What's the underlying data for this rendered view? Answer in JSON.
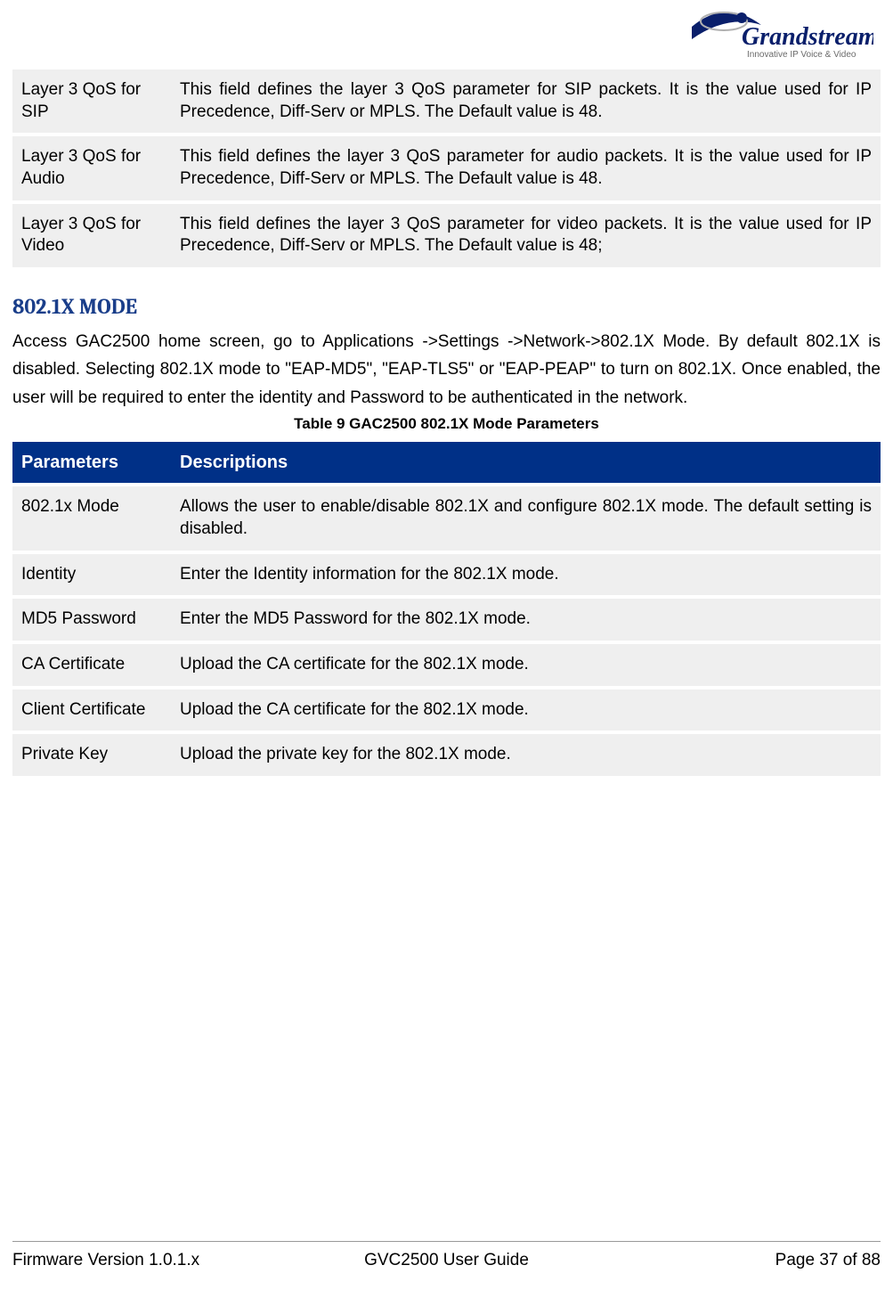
{
  "logo": {
    "brand_name": "Grandstream",
    "tagline": "Innovative IP Voice & Video"
  },
  "qos_table": {
    "rows": [
      {
        "param": "Layer 3 QoS for SIP",
        "desc": "This field defines the layer 3 QoS parameter for SIP packets. It is the value used for IP Precedence, Diff-Serv or MPLS. The Default value is 48."
      },
      {
        "param": "Layer 3 QoS for Audio",
        "desc": "This field defines the layer 3 QoS parameter for audio packets. It is the value used for IP Precedence, Diff-Serv or MPLS. The Default value is 48."
      },
      {
        "param": "Layer 3 QoS for Video",
        "desc": "This field defines the layer 3 QoS parameter for video packets. It is the value used for IP Precedence, Diff-Serv or MPLS. The Default value is 48;"
      }
    ]
  },
  "section": {
    "heading": "802.1X MODE",
    "paragraph": "Access GAC2500 home screen, go to Applications ->Settings ->Network->802.1X Mode. By default 802.1X is disabled. Selecting 802.1X mode to \"EAP-MD5\", \"EAP-TLS5\" or \"EAP-PEAP\" to turn on 802.1X. Once enabled, the user will be required to enter the identity and Password to be authenticated in the network."
  },
  "mode_table": {
    "caption": "Table 9 GAC2500 802.1X Mode Parameters",
    "header": {
      "param": "Parameters",
      "desc": "Descriptions"
    },
    "rows": [
      {
        "param": "802.1x Mode",
        "desc": "Allows the user to enable/disable 802.1X and configure 802.1X mode. The default setting is disabled."
      },
      {
        "param": "Identity",
        "desc": "Enter the Identity information for the 802.1X mode."
      },
      {
        "param": "MD5 Password",
        "desc": "Enter the MD5 Password for the 802.1X mode."
      },
      {
        "param": "CA Certificate",
        "desc": "Upload the CA certificate for the 802.1X mode."
      },
      {
        "param": "Client Certificate",
        "desc": "Upload the CA certificate for the 802.1X mode."
      },
      {
        "param": "Private Key",
        "desc": "Upload the private key for the 802.1X mode."
      }
    ]
  },
  "footer": {
    "left": "Firmware Version 1.0.1.x",
    "center": "GVC2500 User Guide",
    "right": "Page 37 of 88"
  }
}
